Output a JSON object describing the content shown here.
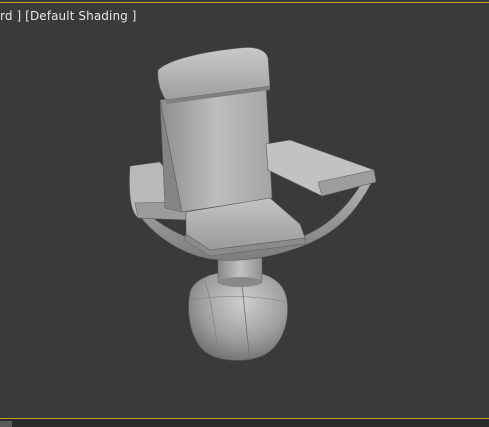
{
  "viewport": {
    "label_part1": "rd ]",
    "label_part2": "[Default Shading ]",
    "frame_color": "#c9a227",
    "background_color": "#3a3a3a"
  },
  "scene": {
    "object": "armchair-3d-model",
    "shading": "default-shading"
  }
}
